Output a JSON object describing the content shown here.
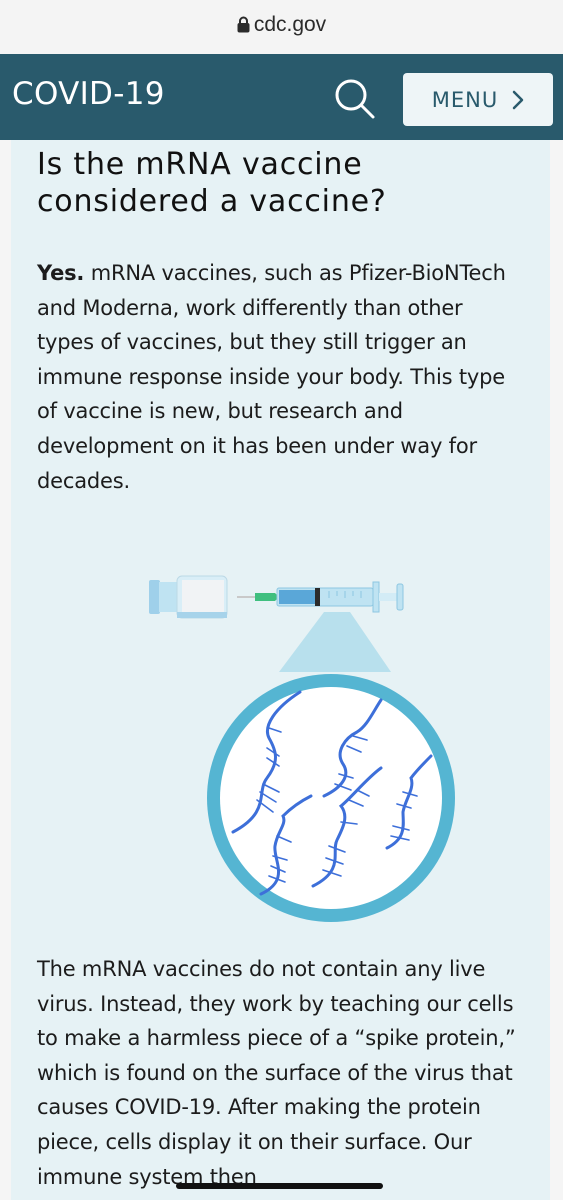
{
  "browser": {
    "url": "cdc.gov",
    "lock_icon": "lock-icon"
  },
  "header": {
    "brand": "COVID-19",
    "search_icon": "search-icon",
    "menu_label": "MENU",
    "menu_icon": "chevron-right-icon",
    "colors": {
      "bar": "#295a6c",
      "button_bg": "#eef5f7"
    }
  },
  "article": {
    "heading": "Is the mRNA vaccine considered a vaccine?",
    "answer_lead": "Yes.",
    "answer_body": "mRNA vaccines, such as Pfizer-BioNTech and Moderna, work differently than other types of vaccines, but they still trigger an immune response inside your body. This type of vaccine is new, but research and development on it has been under way for decades.",
    "illustration_icons": [
      "vaccine-vial-icon",
      "syringe-icon",
      "mrna-strand-icon"
    ],
    "para2": "The mRNA vaccines do not contain any live virus. Instead, they work by teaching our cells to make a harmless piece of a “spike protein,” which is found on the surface of the virus that causes COVID-19. After making the protein piece, cells display it on their surface. Our immune system then",
    "colors": {
      "panel": "#e6f2f5",
      "strand": "#3d6fd9",
      "ring": "#4fb6d3"
    }
  }
}
